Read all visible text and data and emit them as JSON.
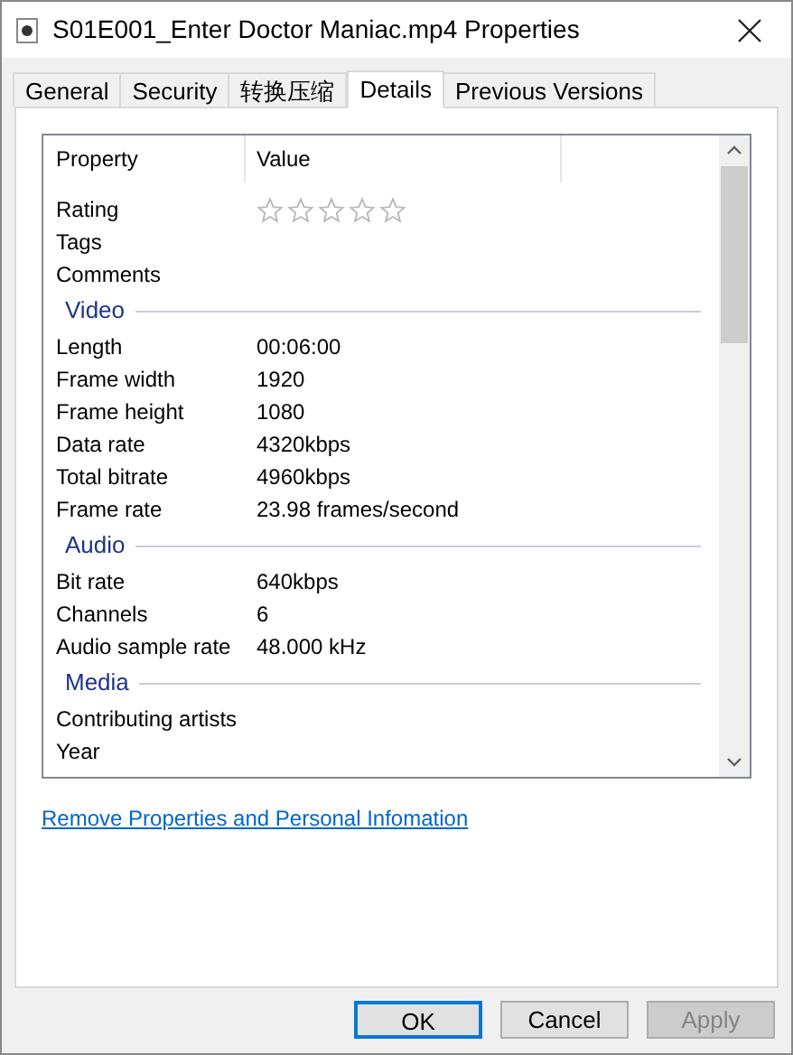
{
  "window": {
    "title": "S01E001_Enter Doctor Maniac.mp4 Properties"
  },
  "tabs": [
    {
      "label": "General",
      "selected": false
    },
    {
      "label": "Security",
      "selected": false
    },
    {
      "label": "转换压缩",
      "selected": false
    },
    {
      "label": "Details",
      "selected": true
    },
    {
      "label": "Previous Versions",
      "selected": false
    }
  ],
  "table": {
    "columns": [
      "Property",
      "Value"
    ],
    "rows": [
      {
        "kind": "stars",
        "property": "Rating",
        "stars": 0
      },
      {
        "kind": "row",
        "property": "Tags"
      },
      {
        "kind": "row",
        "property": "Comments"
      },
      {
        "kind": "group",
        "property": "Video"
      },
      {
        "kind": "row",
        "property": "Length",
        "value": "00:06:00"
      },
      {
        "kind": "row",
        "property": "Frame width",
        "value": "1920"
      },
      {
        "kind": "row",
        "property": "Frame height",
        "value": "1080"
      },
      {
        "kind": "row",
        "property": "Data rate",
        "value": "4320kbps"
      },
      {
        "kind": "row",
        "property": "Total bitrate",
        "value": "4960kbps"
      },
      {
        "kind": "row",
        "property": "Frame rate",
        "value": "23.98 frames/second"
      },
      {
        "kind": "group",
        "property": "Audio"
      },
      {
        "kind": "row",
        "property": "Bit rate",
        "value": "640kbps"
      },
      {
        "kind": "row",
        "property": "Channels",
        "value": "6"
      },
      {
        "kind": "row",
        "property": "Audio sample rate",
        "value": "48.000 kHz"
      },
      {
        "kind": "group",
        "property": "Media"
      },
      {
        "kind": "row",
        "property": "Contributing artists"
      },
      {
        "kind": "row",
        "property": "Year"
      }
    ]
  },
  "link": "Remove Properties and Personal Infomation",
  "buttons": [
    {
      "label": "OK",
      "disabled": false,
      "default": true
    },
    {
      "label": "Cancel",
      "disabled": false,
      "default": false
    },
    {
      "label": "Apply",
      "disabled": true,
      "default": false
    }
  ]
}
